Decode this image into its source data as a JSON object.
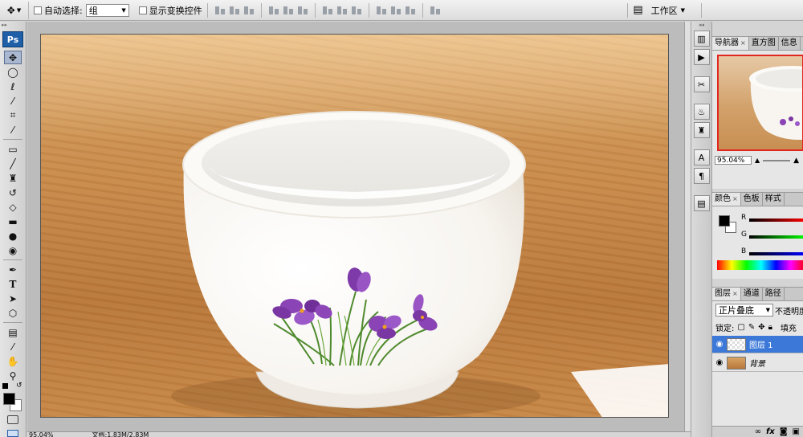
{
  "options_bar": {
    "auto_select_label": "自动选择:",
    "auto_select_value": "组",
    "show_transform_label": "显示变换控件",
    "workspace_label": "工作区"
  },
  "toolbox": {
    "logo": "Ps",
    "tools": [
      "move-icon",
      "marquee-icon",
      "lasso-icon",
      "quick-select-icon",
      "crop-icon",
      "eyedropper-icon",
      "healing-icon",
      "brush-icon",
      "stamp-icon",
      "history-brush-icon",
      "eraser-icon",
      "gradient-icon",
      "blur-icon",
      "dodge-icon",
      "pen-icon",
      "type-icon",
      "path-select-icon",
      "shape-icon",
      "notes-icon",
      "eyedropper2-icon",
      "hand-icon",
      "zoom-icon"
    ],
    "type_glyph": "T",
    "foreground": "#000000",
    "background": "#ffffff"
  },
  "status": {
    "zoom": "95.04%",
    "doc_size": "文档:1.83M/2.83M"
  },
  "navigator_panel": {
    "tabs": [
      "导航器",
      "直方图",
      "信息"
    ],
    "zoom": "95.04%"
  },
  "color_panel": {
    "tabs": [
      "颜色",
      "色板",
      "样式"
    ],
    "channels": [
      "R",
      "G",
      "B"
    ],
    "fg": "#000000",
    "bg": "#ffffff"
  },
  "layers_panel": {
    "tabs": [
      "图层",
      "通道",
      "路径"
    ],
    "blend_mode": "正片叠底",
    "opacity_label": "不透明度",
    "lock_label": "锁定:",
    "fill_label": "填充",
    "layers": [
      {
        "name": "图层 1",
        "selected": true
      },
      {
        "name": "背景",
        "selected": false
      }
    ],
    "footer_fx": "fx"
  }
}
